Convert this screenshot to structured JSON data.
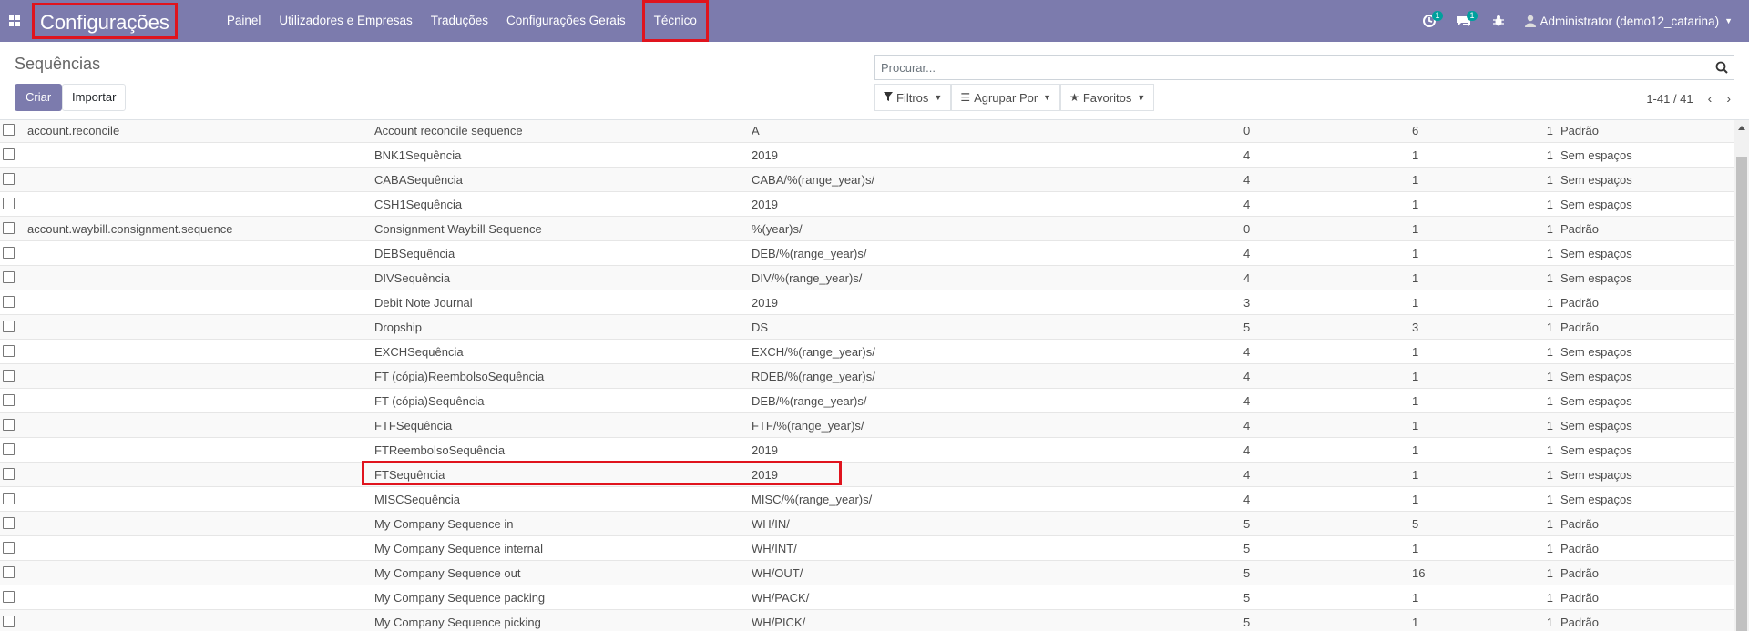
{
  "navbar": {
    "brand": "Configurações",
    "menu": [
      "Painel",
      "Utilizadores e Empresas",
      "Traduções",
      "Configurações Gerais",
      "Técnico"
    ],
    "activity_badge": "1",
    "messages_badge": "1",
    "user": "Administrator (demo12_catarina)",
    "colors": {
      "bar": "#7c7bad",
      "highlight": "#e0141e",
      "badge": "#00a09d"
    }
  },
  "control": {
    "title": "Sequências",
    "create": "Criar",
    "import": "Importar",
    "search_placeholder": "Procurar...",
    "filters": "Filtros",
    "group_by": "Agrupar Por",
    "favorites": "Favoritos",
    "pager": "1-41 / 41"
  },
  "rows": [
    {
      "code": "account.reconcile",
      "name": "Account reconcile sequence",
      "prefix": "A",
      "padding": "0",
      "step": "6",
      "next": "1",
      "impl": "Padrão"
    },
    {
      "code": "",
      "name": "BNK1Sequência",
      "prefix": "2019",
      "padding": "4",
      "step": "1",
      "next": "1",
      "impl": "Sem espaços"
    },
    {
      "code": "",
      "name": "CABASequência",
      "prefix": "CABA/%(range_year)s/",
      "padding": "4",
      "step": "1",
      "next": "1",
      "impl": "Sem espaços"
    },
    {
      "code": "",
      "name": "CSH1Sequência",
      "prefix": "2019",
      "padding": "4",
      "step": "1",
      "next": "1",
      "impl": "Sem espaços"
    },
    {
      "code": "account.waybill.consignment.sequence",
      "name": "Consignment Waybill Sequence",
      "prefix": "%(year)s/",
      "padding": "0",
      "step": "1",
      "next": "1",
      "impl": "Padrão"
    },
    {
      "code": "",
      "name": "DEBSequência",
      "prefix": "DEB/%(range_year)s/",
      "padding": "4",
      "step": "1",
      "next": "1",
      "impl": "Sem espaços"
    },
    {
      "code": "",
      "name": "DIVSequência",
      "prefix": "DIV/%(range_year)s/",
      "padding": "4",
      "step": "1",
      "next": "1",
      "impl": "Sem espaços"
    },
    {
      "code": "",
      "name": "Debit Note Journal",
      "prefix": "2019",
      "padding": "3",
      "step": "1",
      "next": "1",
      "impl": "Padrão"
    },
    {
      "code": "",
      "name": "Dropship",
      "prefix": "DS",
      "padding": "5",
      "step": "3",
      "next": "1",
      "impl": "Padrão"
    },
    {
      "code": "",
      "name": "EXCHSequência",
      "prefix": "EXCH/%(range_year)s/",
      "padding": "4",
      "step": "1",
      "next": "1",
      "impl": "Sem espaços"
    },
    {
      "code": "",
      "name": "FT (cópia)ReembolsoSequência",
      "prefix": "RDEB/%(range_year)s/",
      "padding": "4",
      "step": "1",
      "next": "1",
      "impl": "Sem espaços"
    },
    {
      "code": "",
      "name": "FT (cópia)Sequência",
      "prefix": "DEB/%(range_year)s/",
      "padding": "4",
      "step": "1",
      "next": "1",
      "impl": "Sem espaços"
    },
    {
      "code": "",
      "name": "FTFSequência",
      "prefix": "FTF/%(range_year)s/",
      "padding": "4",
      "step": "1",
      "next": "1",
      "impl": "Sem espaços"
    },
    {
      "code": "",
      "name": "FTReembolsoSequência",
      "prefix": "2019",
      "padding": "4",
      "step": "1",
      "next": "1",
      "impl": "Sem espaços"
    },
    {
      "code": "",
      "name": "FTSequência",
      "prefix": "2019",
      "padding": "4",
      "step": "1",
      "next": "1",
      "impl": "Sem espaços"
    },
    {
      "code": "",
      "name": "MISCSequência",
      "prefix": "MISC/%(range_year)s/",
      "padding": "4",
      "step": "1",
      "next": "1",
      "impl": "Sem espaços"
    },
    {
      "code": "",
      "name": "My Company Sequence in",
      "prefix": "WH/IN/",
      "padding": "5",
      "step": "5",
      "next": "1",
      "impl": "Padrão"
    },
    {
      "code": "",
      "name": "My Company Sequence internal",
      "prefix": "WH/INT/",
      "padding": "5",
      "step": "1",
      "next": "1",
      "impl": "Padrão"
    },
    {
      "code": "",
      "name": "My Company Sequence out",
      "prefix": "WH/OUT/",
      "padding": "5",
      "step": "16",
      "next": "1",
      "impl": "Padrão"
    },
    {
      "code": "",
      "name": "My Company Sequence packing",
      "prefix": "WH/PACK/",
      "padding": "5",
      "step": "1",
      "next": "1",
      "impl": "Padrão"
    },
    {
      "code": "",
      "name": "My Company Sequence picking",
      "prefix": "WH/PICK/",
      "padding": "5",
      "step": "1",
      "next": "1",
      "impl": "Padrão"
    }
  ]
}
